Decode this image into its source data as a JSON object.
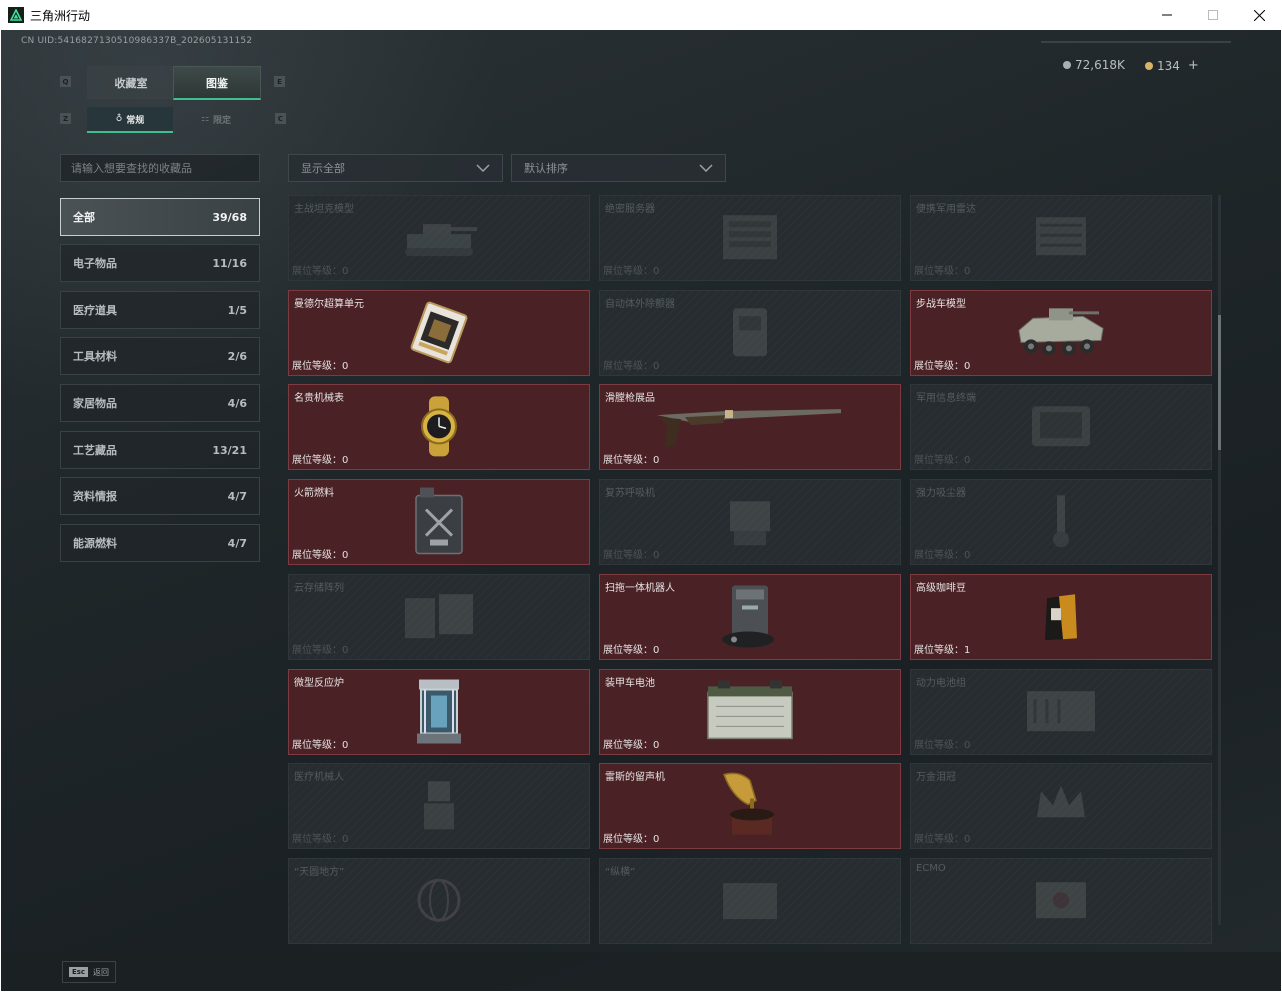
{
  "window": {
    "title": "三角洲行动"
  },
  "header": {
    "uid": "CN UID:5416827130510986337B_202605131152",
    "currency1": "72,618K",
    "currency2": "134",
    "add_label": "+"
  },
  "tabs": [
    {
      "label": "收藏室",
      "active": false
    },
    {
      "label": "图鉴",
      "active": true
    }
  ],
  "subtabs": [
    {
      "label": "常规",
      "active": true
    },
    {
      "label": "限定",
      "active": false
    }
  ],
  "search": {
    "placeholder": "请输入想要查找的收藏品"
  },
  "filters": {
    "show_all": "显示全部",
    "sort": "默认排序"
  },
  "categories": [
    {
      "label": "全部",
      "count": "39/68"
    },
    {
      "label": "电子物品",
      "count": "11/16"
    },
    {
      "label": "医疗道具",
      "count": "1/5"
    },
    {
      "label": "工具材料",
      "count": "2/6"
    },
    {
      "label": "家居物品",
      "count": "4/6"
    },
    {
      "label": "工艺藏品",
      "count": "13/21"
    },
    {
      "label": "资料情报",
      "count": "4/7"
    },
    {
      "label": "能源燃料",
      "count": "4/7"
    }
  ],
  "items": [
    {
      "name": "主战坦克模型",
      "level": "展位等级：0",
      "owned": false,
      "icon": "tank-icon"
    },
    {
      "name": "绝密服务器",
      "level": "展位等级：0",
      "owned": false,
      "icon": "server-icon"
    },
    {
      "name": "便携军用雷达",
      "level": "展位等级：0",
      "owned": false,
      "icon": "radar-icon"
    },
    {
      "name": "曼德尔超算单元",
      "level": "展位等级：0",
      "owned": true,
      "icon": "cpu-icon"
    },
    {
      "name": "自动体外除颤器",
      "level": "展位等级：0",
      "owned": false,
      "icon": "defibrillator-icon"
    },
    {
      "name": "步战车模型",
      "level": "展位等级：0",
      "owned": true,
      "icon": "ifv-icon"
    },
    {
      "name": "名贵机械表",
      "level": "展位等级：0",
      "owned": true,
      "icon": "watch-icon"
    },
    {
      "name": "滑膛枪展品",
      "level": "展位等级：0",
      "owned": true,
      "icon": "musket-icon"
    },
    {
      "name": "军用信息终端",
      "level": "展位等级：0",
      "owned": false,
      "icon": "terminal-icon"
    },
    {
      "name": "火箭燃料",
      "level": "展位等级：0",
      "owned": true,
      "icon": "fuel-can-icon"
    },
    {
      "name": "复苏呼吸机",
      "level": "展位等级：0",
      "owned": false,
      "icon": "ventilator-icon"
    },
    {
      "name": "强力吸尘器",
      "level": "展位等级：0",
      "owned": false,
      "icon": "vacuum-icon"
    },
    {
      "name": "云存储阵列",
      "level": "展位等级：0",
      "owned": false,
      "icon": "storage-icon"
    },
    {
      "name": "扫拖一体机器人",
      "level": "展位等级：0",
      "owned": true,
      "icon": "robot-vacuum-icon"
    },
    {
      "name": "高级咖啡豆",
      "level": "展位等级：1",
      "owned": true,
      "icon": "coffee-bag-icon"
    },
    {
      "name": "微型反应炉",
      "level": "展位等级：0",
      "owned": true,
      "icon": "reactor-icon"
    },
    {
      "name": "装甲车电池",
      "level": "展位等级：0",
      "owned": true,
      "icon": "battery-icon"
    },
    {
      "name": "动力电池组",
      "level": "展位等级：0",
      "owned": false,
      "icon": "battery-pack-icon"
    },
    {
      "name": "医疗机械人",
      "level": "展位等级：0",
      "owned": false,
      "icon": "med-robot-icon"
    },
    {
      "name": "雷斯的留声机",
      "level": "展位等级：0",
      "owned": true,
      "icon": "gramophone-icon"
    },
    {
      "name": "万金泪冠",
      "level": "展位等级：0",
      "owned": false,
      "icon": "crown-icon"
    },
    {
      "name": "“天圆地方”",
      "level": "",
      "owned": false,
      "icon": "globe-icon"
    },
    {
      "name": "“纵横”",
      "level": "",
      "owned": false,
      "icon": "board-icon"
    },
    {
      "name": "ECMO",
      "level": "",
      "owned": false,
      "icon": "ecmo-icon"
    }
  ],
  "footer": {
    "esc_key": "Esc",
    "esc_label": "返回"
  },
  "colors": {
    "owned_bg": "#4a2226",
    "accent": "#3fbf8f"
  }
}
